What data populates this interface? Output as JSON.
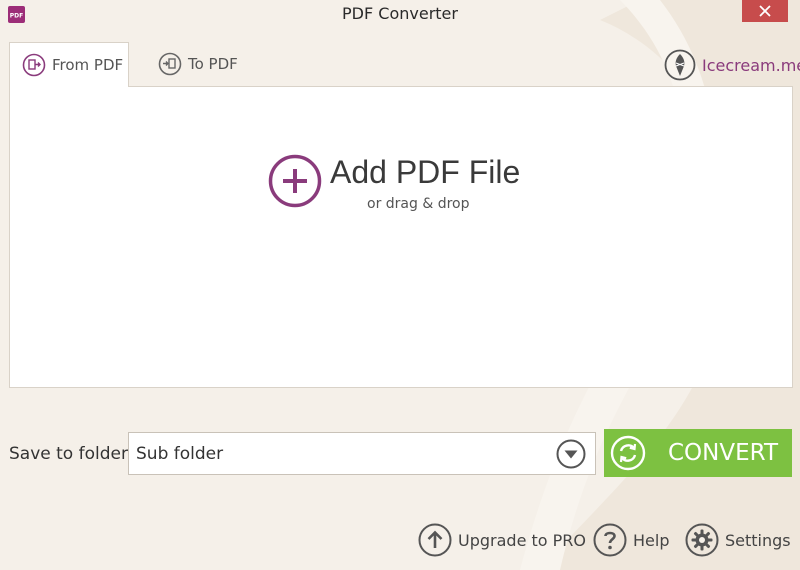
{
  "window": {
    "title": "PDF Converter",
    "app_icon_text": "PDF"
  },
  "tabs": [
    {
      "label": "From PDF",
      "active": true
    },
    {
      "label": "To PDF",
      "active": false
    }
  ],
  "brand": {
    "label": "Icecream.me"
  },
  "drop_area": {
    "title": "Add PDF File",
    "subtitle": "or drag & drop"
  },
  "save": {
    "label": "Save to folder:",
    "value": "Sub folder"
  },
  "convert": {
    "label": "CONVERT"
  },
  "footer": {
    "upgrade": "Upgrade to PRO",
    "help": "Help",
    "settings": "Settings"
  },
  "colors": {
    "accent": "#8a3b7c",
    "convert_green": "#7dc141",
    "close_red": "#c74c4c",
    "background": "#f5f0e9"
  },
  "icons": [
    "app-logo-icon",
    "close-icon",
    "from-pdf-icon",
    "to-pdf-icon",
    "icecream-icon",
    "add-circle-icon",
    "chevron-down-icon",
    "refresh-icon",
    "arrow-up-icon",
    "question-icon",
    "gear-icon"
  ]
}
